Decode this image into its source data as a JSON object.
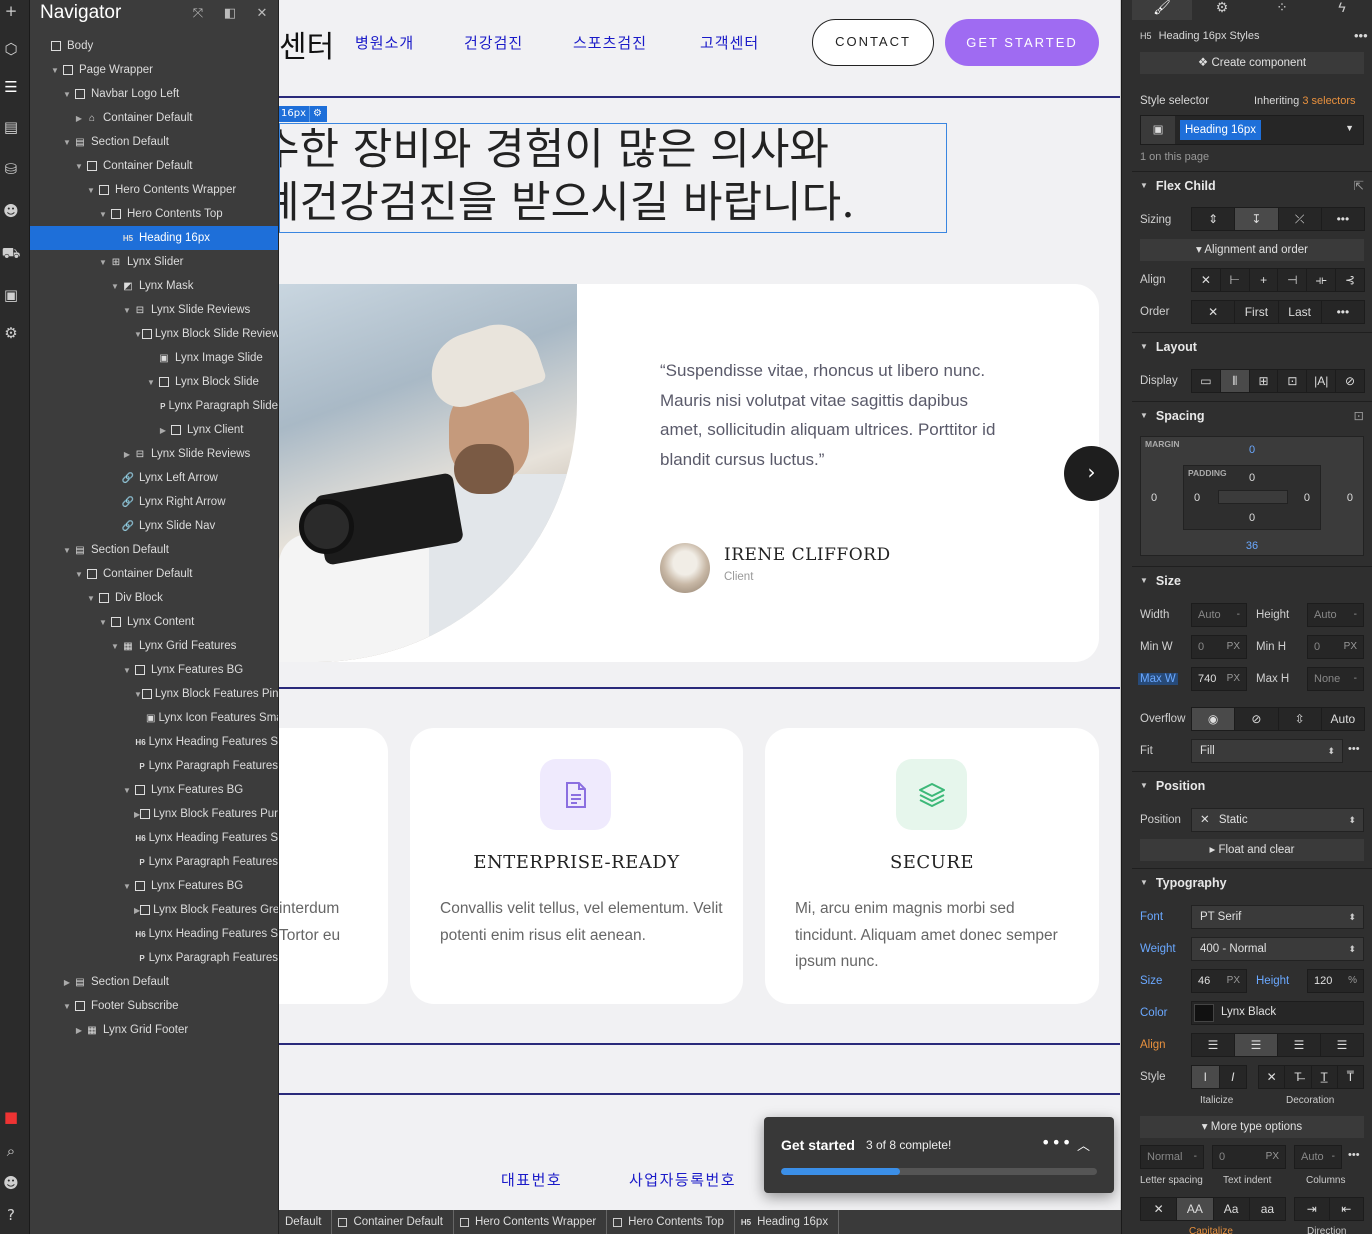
{
  "navigator": {
    "title": "Navigator",
    "tree": [
      {
        "label": "Body",
        "depth": 0,
        "caret": "",
        "icon": "box"
      },
      {
        "label": "Page Wrapper",
        "depth": 1,
        "caret": "down",
        "icon": "box"
      },
      {
        "label": "Navbar Logo Left",
        "depth": 2,
        "caret": "down",
        "icon": "box"
      },
      {
        "label": "Container Default",
        "depth": 3,
        "caret": "right",
        "icon": "home"
      },
      {
        "label": "Section Default",
        "depth": 2,
        "caret": "down",
        "icon": "section"
      },
      {
        "label": "Container Default",
        "depth": 3,
        "caret": "down",
        "icon": "box"
      },
      {
        "label": "Hero Contents Wrapper",
        "depth": 4,
        "caret": "down",
        "icon": "box"
      },
      {
        "label": "Hero Contents Top",
        "depth": 5,
        "caret": "down",
        "icon": "box"
      },
      {
        "label": "Heading 16px",
        "depth": 6,
        "caret": "",
        "icon": "H5",
        "selected": true
      },
      {
        "label": "Lynx Slider",
        "depth": 5,
        "caret": "down",
        "icon": "slider"
      },
      {
        "label": "Lynx Mask",
        "depth": 6,
        "caret": "down",
        "icon": "mask"
      },
      {
        "label": "Lynx Slide Reviews",
        "depth": 7,
        "caret": "down",
        "icon": "slide"
      },
      {
        "label": "Lynx Block Slide Reviews",
        "depth": 8,
        "caret": "down",
        "icon": "box"
      },
      {
        "label": "Lynx Image Slide",
        "depth": 9,
        "caret": "",
        "icon": "image"
      },
      {
        "label": "Lynx Block Slide",
        "depth": 9,
        "caret": "down",
        "icon": "box"
      },
      {
        "label": "Lynx Paragraph Slide",
        "depth": 10,
        "caret": "",
        "icon": "P"
      },
      {
        "label": "Lynx Client",
        "depth": 10,
        "caret": "right",
        "icon": "box"
      },
      {
        "label": "Lynx Slide Reviews",
        "depth": 7,
        "caret": "right",
        "icon": "slide"
      },
      {
        "label": "Lynx Left Arrow",
        "depth": 6,
        "caret": "",
        "icon": "link"
      },
      {
        "label": "Lynx Right Arrow",
        "depth": 6,
        "caret": "",
        "icon": "link"
      },
      {
        "label": "Lynx Slide Nav",
        "depth": 6,
        "caret": "",
        "icon": "link"
      },
      {
        "label": "Section Default",
        "depth": 2,
        "caret": "down",
        "icon": "section"
      },
      {
        "label": "Container Default",
        "depth": 3,
        "caret": "down",
        "icon": "box"
      },
      {
        "label": "Div Block",
        "depth": 4,
        "caret": "down",
        "icon": "box"
      },
      {
        "label": "Lynx Content",
        "depth": 5,
        "caret": "down",
        "icon": "box"
      },
      {
        "label": "Lynx Grid Features",
        "depth": 6,
        "caret": "down",
        "icon": "grid"
      },
      {
        "label": "Lynx Features BG",
        "depth": 7,
        "caret": "down",
        "icon": "box"
      },
      {
        "label": "Lynx Block Features Pink",
        "depth": 8,
        "caret": "down",
        "icon": "box"
      },
      {
        "label": "Lynx Icon Features Small",
        "depth": 9,
        "caret": "",
        "icon": "image"
      },
      {
        "label": "Lynx Heading Features S",
        "depth": 8,
        "caret": "",
        "icon": "H6"
      },
      {
        "label": "Lynx Paragraph Features",
        "depth": 8,
        "caret": "",
        "icon": "P"
      },
      {
        "label": "Lynx Features BG",
        "depth": 7,
        "caret": "down",
        "icon": "box"
      },
      {
        "label": "Lynx Block Features Purple",
        "depth": 8,
        "caret": "right",
        "icon": "box"
      },
      {
        "label": "Lynx Heading Features S",
        "depth": 8,
        "caret": "",
        "icon": "H6"
      },
      {
        "label": "Lynx Paragraph Features",
        "depth": 8,
        "caret": "",
        "icon": "P"
      },
      {
        "label": "Lynx Features BG",
        "depth": 7,
        "caret": "down",
        "icon": "box"
      },
      {
        "label": "Lynx Block Features Green",
        "depth": 8,
        "caret": "right",
        "icon": "box"
      },
      {
        "label": "Lynx Heading Features S",
        "depth": 8,
        "caret": "",
        "icon": "H6"
      },
      {
        "label": "Lynx Paragraph Features",
        "depth": 8,
        "caret": "",
        "icon": "P"
      },
      {
        "label": "Section Default",
        "depth": 2,
        "caret": "right",
        "icon": "section"
      },
      {
        "label": "Footer Subscribe",
        "depth": 2,
        "caret": "down",
        "icon": "box"
      },
      {
        "label": "Lynx Grid Footer",
        "depth": 3,
        "caret": "right",
        "icon": "grid"
      }
    ]
  },
  "site": {
    "logo_fragment": "센터",
    "menu": [
      "병원소개",
      "건강검진",
      "스포츠검진",
      "고객센터"
    ],
    "contact_label": "CONTACT",
    "get_started_label": "GET STARTED",
    "selection_badge": "16px",
    "heading_lines": [
      "수한 장비와 경험이 많은 의사와",
      "계건강검진을 받으시길 바랍니다."
    ],
    "review": {
      "quote": "“Suspendisse vitae, rhoncus ut libero nunc. Mauris nisi volutpat vitae sagittis dapibus amet, sollicitudin aliquam ultrices. Porttitor id blandit cursus luctus.”",
      "name": "IRENE CLIFFORD",
      "role": "Client"
    },
    "features": [
      {
        "title": "",
        "text": "interdum\nTortor eu"
      },
      {
        "title": "ENTERPRISE-READY",
        "text": "Convallis velit tellus, vel elementum. Velit potenti enim risus elit aenean."
      },
      {
        "title": "SECURE",
        "text": "Mi, arcu enim magnis morbi sed tincidunt. Aliquam amet donec semper ipsum nunc."
      }
    ],
    "footer_links": [
      "대표번호",
      "사업자등록번호"
    ],
    "colors": {
      "accent": "#9f6bf2",
      "link": "#1a1ac8",
      "selection": "#1e6fd9"
    }
  },
  "toast": {
    "title": "Get started",
    "status": "3 of 8 complete!",
    "progress": 0.375
  },
  "breadcrumbs": [
    {
      "label": "Default",
      "icon": ""
    },
    {
      "label": "Container Default",
      "icon": "box"
    },
    {
      "label": "Hero Contents Wrapper",
      "icon": "box"
    },
    {
      "label": "Hero Contents Top",
      "icon": "box"
    },
    {
      "label": "Heading 16px",
      "icon": "H5"
    }
  ],
  "panel": {
    "element_label": "Heading 16px Styles",
    "element_tag": "H5",
    "create_component": "Create component",
    "style_selector_label": "Style selector",
    "inheriting_label": "Inheriting",
    "inheriting_count": "3 selectors",
    "selector_chip": "Heading 16px",
    "on_page": "1 on this page",
    "flex_child": "Flex Child",
    "sizing_label": "Sizing",
    "alignment_order": "Alignment and order",
    "align_label": "Align",
    "order_label": "Order",
    "order_first": "First",
    "order_last": "Last",
    "layout": "Layout",
    "display_label": "Display",
    "spacing": "Spacing",
    "margin_label": "MARGIN",
    "padding_label": "PADDING",
    "margin": {
      "top": "0",
      "right": "0",
      "bottom": "36",
      "left": "0"
    },
    "padding": {
      "top": "0",
      "right": "0",
      "bottom": "0",
      "left": "0"
    },
    "size": "Size",
    "width_label": "Width",
    "width_val": "Auto",
    "height_label": "Height",
    "height_val": "Auto",
    "minw_label": "Min W",
    "minw_val": "0",
    "minw_unit": "PX",
    "minh_label": "Min H",
    "minh_val": "0",
    "minh_unit": "PX",
    "maxw_label": "Max W",
    "maxw_val": "740",
    "maxw_unit": "PX",
    "maxh_label": "Max H",
    "maxh_val": "None",
    "overflow_label": "Overflow",
    "overflow_auto": "Auto",
    "fit_label": "Fit",
    "fit_val": "Fill",
    "position_h": "Position",
    "position_label": "Position",
    "position_val": "Static",
    "float_clear": "Float and clear",
    "typography": "Typography",
    "font_label": "Font",
    "font_val": "PT Serif",
    "weight_label": "Weight",
    "weight_val": "400 - Normal",
    "size_label": "Size",
    "size_val": "46",
    "size_unit": "PX",
    "lineheight_label": "Height",
    "lineheight_val": "120",
    "lineheight_unit": "%",
    "color_label": "Color",
    "color_val": "Lynx Black",
    "align_t_label": "Align",
    "style_label": "Style",
    "italicize": "Italicize",
    "decoration": "Decoration",
    "more_type": "More type options",
    "ls_val": "Normal",
    "ti_val": "0",
    "ti_unit": "PX",
    "col_val": "Auto",
    "letter_spacing": "Letter spacing",
    "text_indent": "Text indent",
    "columns": "Columns",
    "capitalize": "Capitalize",
    "direction": "Direction"
  }
}
